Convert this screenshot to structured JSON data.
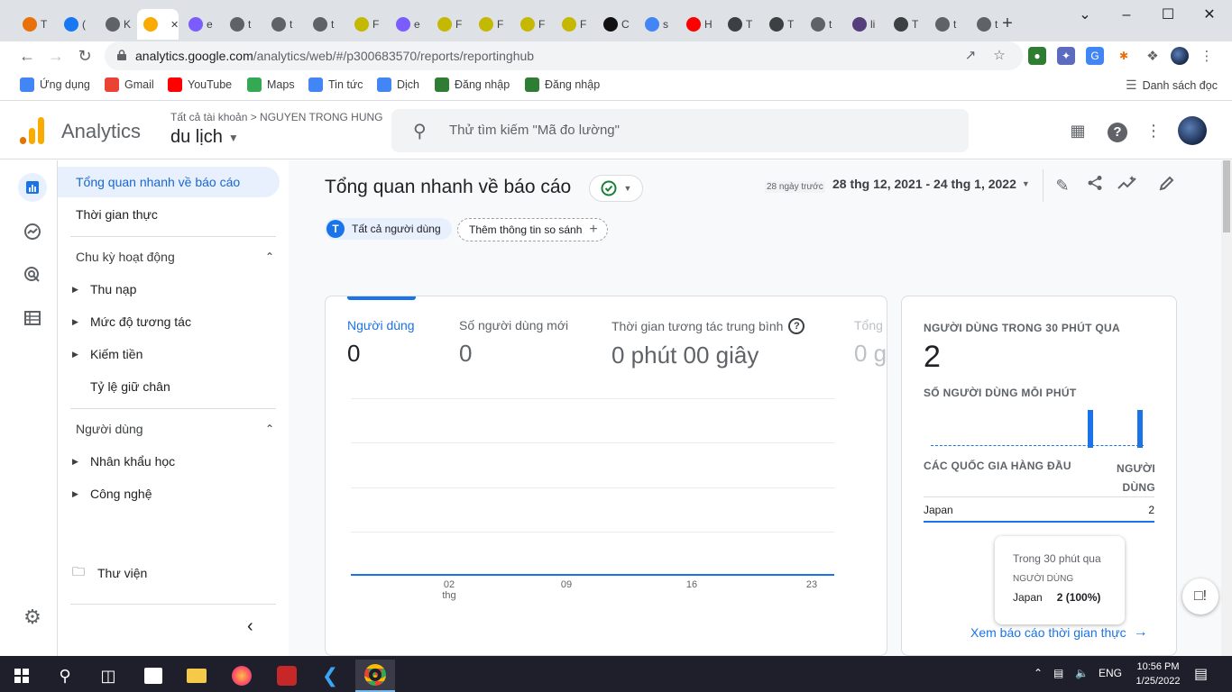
{
  "browser": {
    "tabs": [
      {
        "letter": "T",
        "color": "#e8710a",
        "icon": "person-icon"
      },
      {
        "letter": "(",
        "color": "#1877f2",
        "icon": "facebook-icon"
      },
      {
        "letter": "K",
        "color": "#5f6368",
        "icon": "translate-icon"
      },
      {
        "letter": "A",
        "color": "#f9ab00",
        "icon": "analytics-icon"
      },
      {
        "letter": "e",
        "color": "#7b5cff",
        "icon": "infinity-icon"
      },
      {
        "letter": "t",
        "color": "#5f6368",
        "icon": "globe-icon"
      },
      {
        "letter": "t",
        "color": "#5f6368",
        "icon": "globe-icon"
      },
      {
        "letter": "t",
        "color": "#5f6368",
        "icon": "globe-icon"
      },
      {
        "letter": "F",
        "color": "#c5b800",
        "icon": "eye-icon"
      },
      {
        "letter": "e",
        "color": "#7b5cff",
        "icon": "infinity-icon"
      },
      {
        "letter": "F",
        "color": "#c5b800",
        "icon": "eye-icon"
      },
      {
        "letter": "F",
        "color": "#c5b800",
        "icon": "eye-icon"
      },
      {
        "letter": "F",
        "color": "#c5b800",
        "icon": "eye-icon"
      },
      {
        "letter": "F",
        "color": "#c5b800",
        "icon": "eye-icon"
      },
      {
        "letter": "C",
        "color": "#111111",
        "icon": "ai-icon"
      },
      {
        "letter": "s",
        "color": "#4285f4",
        "icon": "google-icon"
      },
      {
        "letter": "H",
        "color": "#ff0000",
        "icon": "youtube-icon"
      },
      {
        "letter": "T",
        "color": "#3c4043",
        "icon": "chrome-icon"
      },
      {
        "letter": "T",
        "color": "#3c4043",
        "icon": "chrome-icon"
      },
      {
        "letter": "t",
        "color": "#5f6368",
        "icon": "globe-icon"
      },
      {
        "letter": "li",
        "color": "#563d7c",
        "icon": "bootstrap-icon"
      },
      {
        "letter": "T",
        "color": "#3c4043",
        "icon": "chrome-icon"
      },
      {
        "letter": "t",
        "color": "#5f6368",
        "icon": "globe-icon"
      },
      {
        "letter": "t",
        "color": "#5f6368",
        "icon": "globe-icon"
      }
    ],
    "active_tab_letter": "A",
    "url_host": "analytics.google.com",
    "url_path": "/analytics/web/#/p300683570/reports/reportinghub",
    "bookmarks": [
      {
        "label": "Ứng dụng",
        "icon": "apps-grid-icon",
        "color": "#4285f4"
      },
      {
        "label": "Gmail",
        "icon": "gmail-icon",
        "color": "#ea4335"
      },
      {
        "label": "YouTube",
        "icon": "youtube-icon",
        "color": "#ff0000"
      },
      {
        "label": "Maps",
        "icon": "maps-icon",
        "color": "#34a853"
      },
      {
        "label": "Tin tức",
        "icon": "news-icon",
        "color": "#4285f4"
      },
      {
        "label": "Dịch",
        "icon": "translate-icon",
        "color": "#4285f4"
      },
      {
        "label": "Đăng nhập",
        "icon": "login-icon",
        "color": "#2e7d32"
      },
      {
        "label": "Đăng nhập",
        "icon": "login-icon",
        "color": "#2e7d32"
      }
    ],
    "reading_list": "Danh sách đọc"
  },
  "header": {
    "app_name": "Analytics",
    "breadcrumb": "Tất cả tài khoản > NGUYEN TRONG HUNG",
    "property": "du lịch",
    "search_placeholder": "Thử tìm kiếm \"Mã đo lường\""
  },
  "nav": {
    "overview": "Tổng quan nhanh về báo cáo",
    "realtime": "Thời gian thực",
    "lifecycle": "Chu kỳ hoạt động",
    "lifecycle_items": [
      "Thu nạp",
      "Mức độ tương tác",
      "Kiếm tiền",
      "Tỷ lệ giữ chân"
    ],
    "users": "Người dùng",
    "users_items": [
      "Nhân khẩu học",
      "Công nghệ"
    ],
    "library": "Thư viện"
  },
  "main": {
    "title": "Tổng quan nhanh về báo cáo",
    "date_hint": "28 ngày trước",
    "date_range": "28 thg 12, 2021 - 24 thg 1, 2022",
    "chip_all_users": "Tất cả người dùng",
    "chip_all_users_letter": "T",
    "chip_compare": "Thêm thông tin so sánh",
    "metrics": [
      {
        "label": "Người dùng",
        "value": "0"
      },
      {
        "label": "Số người dùng mới",
        "value": "0"
      },
      {
        "label": "Thời gian tương tác trung bình",
        "value": "0 phút 00 giây"
      },
      {
        "label": "Tổng",
        "value": "0 g"
      }
    ],
    "x_ticks": [
      "02",
      "09",
      "16",
      "23"
    ],
    "x_sub": "thg"
  },
  "realtime_card": {
    "title": "NGƯỜI DÙNG TRONG 30 PHÚT QUA",
    "value": "2",
    "per_minute": "SỐ NGƯỜI DÙNG MỖI PHÚT",
    "countries_header": "CÁC QUỐC GIA HÀNG ĐẦU",
    "users_header_1": "NGƯỜI",
    "users_header_2": "DÙNG",
    "rows": [
      {
        "country": "Japan",
        "users": "2"
      }
    ],
    "per_minute_values": [
      0,
      0,
      0,
      0,
      0,
      0,
      0,
      0,
      0,
      0,
      0,
      0,
      0,
      0,
      0,
      0,
      0,
      0,
      0,
      0,
      0,
      0,
      1,
      0,
      0,
      0,
      0,
      0,
      0,
      1
    ],
    "tooltip": {
      "title": "Trong 30 phút qua",
      "metric": "NGƯỜI DÙNG",
      "country": "Japan",
      "value": "2 (100%)"
    },
    "link": "Xem báo cáo thời gian thực"
  },
  "taskbar": {
    "lang": "ENG",
    "time": "10:56 PM",
    "date": "1/25/2022"
  },
  "colors": {
    "accent": "#1a73e8",
    "ga_orange": "#f9ab00",
    "ga_dark_orange": "#e37400"
  }
}
